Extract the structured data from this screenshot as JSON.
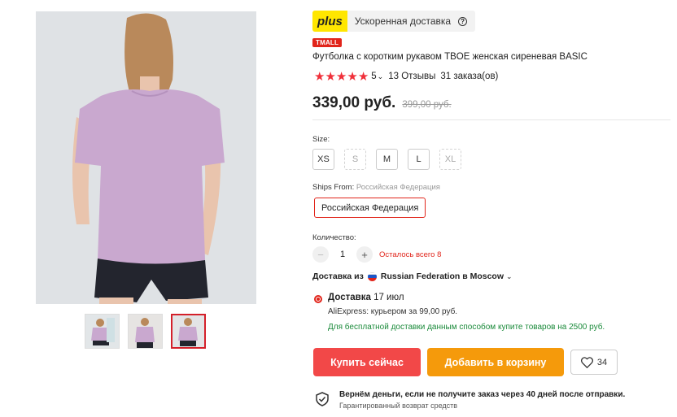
{
  "gallery": {
    "main_image": "tshirt-back-view-photo",
    "thumbnails": [
      {
        "name": "tshirt-model-thumb-1",
        "active": false
      },
      {
        "name": "tshirt-model-thumb-2",
        "active": false
      },
      {
        "name": "tshirt-model-thumb-3",
        "active": true
      }
    ]
  },
  "badge": {
    "plus_logo": "plus",
    "delivery_label": "Ускоренная доставка",
    "help_icon": "question-circle-icon"
  },
  "tmall_label": "TMALL",
  "product": {
    "title": "Футболка с коротким рукавом TBOE женская сиреневая BASIC",
    "rating_value": "5",
    "stars": 5,
    "reviews": "13 Отзывы",
    "orders": "31 заказа(ов)",
    "price": "339,00 руб.",
    "old_price": "399,00 руб."
  },
  "size": {
    "label": "Size:",
    "options": [
      {
        "label": "XS",
        "available": true
      },
      {
        "label": "S",
        "available": false
      },
      {
        "label": "M",
        "available": true
      },
      {
        "label": "L",
        "available": true
      },
      {
        "label": "XL",
        "available": false
      }
    ]
  },
  "ships_from": {
    "label": "Ships From:",
    "value": "Российская Федерация",
    "button": "Российская Федерация"
  },
  "quantity": {
    "label": "Количество:",
    "minus": "−",
    "plus": "+",
    "value": "1",
    "remaining": "Осталось всего 8"
  },
  "delivery": {
    "from_prefix": "Доставка из",
    "from_location": "Russian Federation в Moscow",
    "title": "Доставка",
    "date": "17 июл",
    "courier": "AliExpress: курьером за 99,00 руб.",
    "free_note": "Для бесплатной доставки данным способом купите товаров на 2500 руб."
  },
  "actions": {
    "buy": "Купить сейчас",
    "add_to_cart": "Добавить в корзину",
    "wishlist_count": "34"
  },
  "guarantee": {
    "title": "Вернём деньги, если не получите заказ через 40 дней после отправки.",
    "subtitle": "Гарантированный возврат средств"
  },
  "colors": {
    "accent_red": "#f24848",
    "cart_orange": "#f59a0b",
    "tshirt_lilac": "#c9a8cf",
    "free_ship_green": "#1a8a3a"
  }
}
